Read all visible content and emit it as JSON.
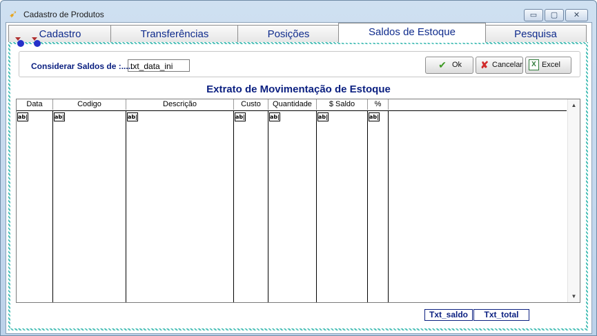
{
  "window": {
    "title": "Cadastro de Produtos",
    "controls": {
      "minimize": "▭",
      "maximize": "▢",
      "close": "✕"
    }
  },
  "tabs": [
    {
      "label": "Cadastro",
      "active": false
    },
    {
      "label": "Transferências",
      "active": false
    },
    {
      "label": "Posições",
      "active": false
    },
    {
      "label": "Saldos de Estoque",
      "active": true
    },
    {
      "label": "Pesquisa",
      "active": false
    }
  ],
  "filter": {
    "label": "Considerar Saldos de :.....",
    "date_value": "txt_data_ini"
  },
  "buttons": {
    "ok": "Ok",
    "cancel": "Cancelar",
    "excel": "Excel"
  },
  "report": {
    "title": "Extrato de Movimentação de Estoque",
    "columns": [
      "Data",
      "Codigo",
      "Descrição",
      "Custo",
      "Quantidade",
      "$ Saldo",
      "%"
    ],
    "cell_placeholder": "ab|"
  },
  "totals": {
    "saldo": "Txt_saldo",
    "total": "Txt_total"
  },
  "colors": {
    "accent": "#0a1f80",
    "hatch": "#4cc0b8",
    "window_frame": "#bcd2ea"
  }
}
